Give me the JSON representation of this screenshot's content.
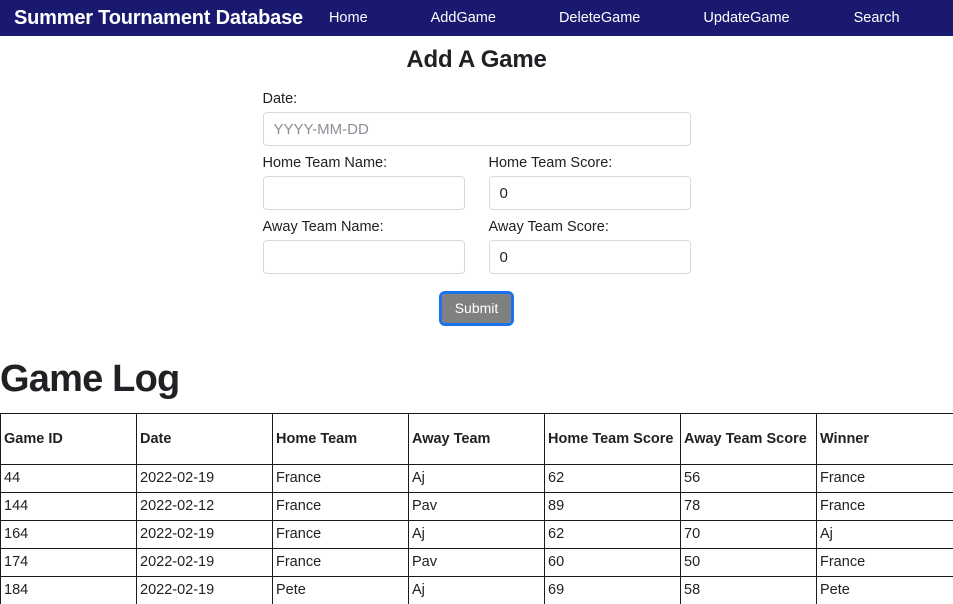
{
  "navbar": {
    "brand": "Summer Tournament Database",
    "links": [
      {
        "label": "Home"
      },
      {
        "label": "AddGame"
      },
      {
        "label": "DeleteGame"
      },
      {
        "label": "UpdateGame"
      },
      {
        "label": "Search"
      }
    ],
    "background_color": "#191970",
    "text_color": "#ffffff"
  },
  "form": {
    "title": "Add A Game",
    "date": {
      "label": "Date:",
      "placeholder": "YYYY-MM-DD",
      "value": ""
    },
    "home_team_name": {
      "label": "Home Team Name:",
      "placeholder": "",
      "value": ""
    },
    "home_team_score": {
      "label": "Home Team Score:",
      "placeholder": "",
      "value": "0"
    },
    "away_team_name": {
      "label": "Away Team Name:",
      "placeholder": "",
      "value": ""
    },
    "away_team_score": {
      "label": "Away Team Score:",
      "placeholder": "",
      "value": "0"
    },
    "submit_label": "Submit",
    "submit_bg_color": "#808080",
    "submit_focus_color": "#1a73e8"
  },
  "game_log": {
    "title": "Game Log",
    "columns": [
      "Game ID",
      "Date",
      "Home Team",
      "Away Team",
      "Home Team Score",
      "Away Team Score",
      "Winner"
    ],
    "rows": [
      {
        "game_id": "44",
        "date": "2022-02-19",
        "home_team": "France",
        "away_team": "Aj",
        "home_team_score": "62",
        "away_team_score": "56",
        "winner": "France"
      },
      {
        "game_id": "144",
        "date": "2022-02-12",
        "home_team": "France",
        "away_team": "Pav",
        "home_team_score": "89",
        "away_team_score": "78",
        "winner": "France"
      },
      {
        "game_id": "164",
        "date": "2022-02-19",
        "home_team": "France",
        "away_team": "Aj",
        "home_team_score": "62",
        "away_team_score": "70",
        "winner": "Aj"
      },
      {
        "game_id": "174",
        "date": "2022-02-19",
        "home_team": "France",
        "away_team": "Pav",
        "home_team_score": "60",
        "away_team_score": "50",
        "winner": "France"
      },
      {
        "game_id": "184",
        "date": "2022-02-19",
        "home_team": "Pete",
        "away_team": "Aj",
        "home_team_score": "69",
        "away_team_score": "58",
        "winner": "Pete"
      }
    ]
  }
}
